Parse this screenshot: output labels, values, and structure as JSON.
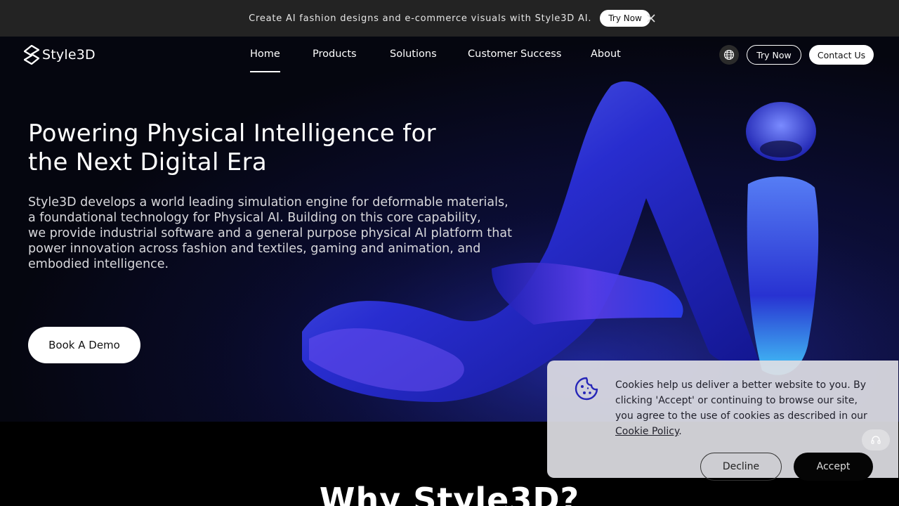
{
  "announcement": {
    "text": "Create AI fashion designs and e-commerce visuals with Style3D AI.",
    "button_label": "Try Now",
    "close_icon": "close-icon"
  },
  "header": {
    "logo_text": "Style3D",
    "nav": [
      {
        "label": "Home",
        "active": true
      },
      {
        "label": "Products"
      },
      {
        "label": "Solutions"
      },
      {
        "label": "Customer Success"
      },
      {
        "label": "About"
      }
    ],
    "language_icon": "globe-icon",
    "try_label": "Try Now",
    "contact_label": "Contact Us"
  },
  "hero": {
    "title_line1": "Powering Physical Intelligence for",
    "title_line2": "the Next Digital Era",
    "desc_lines": [
      "Style3D develops a world leading simulation engine for deformable materials,",
      "a foundational technology for Physical AI. Building on this core capability,",
      "we provide industrial software and a general purpose physical AI platform that",
      "power innovation across fashion and textiles, gaming and animation, and",
      "embodied intelligence."
    ],
    "cta_label": "Book A Demo"
  },
  "why": {
    "title": "Why Style3D?"
  },
  "cookie_banner": {
    "line1": "Cookies help us deliver a better website to you. By",
    "line2": "clicking 'Accept' or continuing to browse our site,",
    "line3": "you agree to the use of cookies as described in our",
    "link_text": "Cookie Policy",
    "link_suffix": ".",
    "decline_label": "Decline",
    "accept_label": "Accept"
  },
  "colors": {
    "announce_bg": "#232323",
    "accent_blue": "#2b2fd6",
    "cookie_icon": "#2626b8"
  }
}
